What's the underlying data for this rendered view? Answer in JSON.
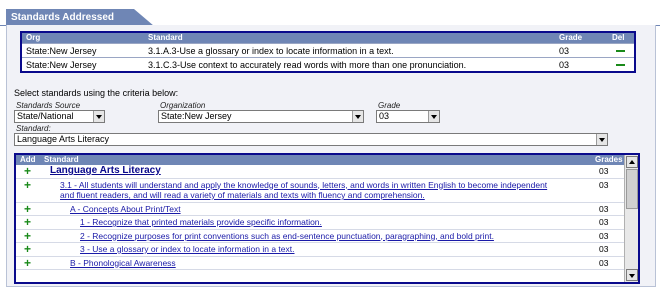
{
  "tab": {
    "title": "Standards Addressed"
  },
  "addressed": {
    "headers": {
      "org": "Org",
      "standard": "Standard",
      "grade": "Grade",
      "del": "Del"
    },
    "rows": [
      {
        "org": "State:New Jersey",
        "standard": "3.1.A.3-Use a glossary or index to locate information in a text.",
        "grade": "03"
      },
      {
        "org": "State:New Jersey",
        "standard": "3.1.C.3-Use context to accurately read words with more than one pronunciation.",
        "grade": "03"
      }
    ]
  },
  "criteria": {
    "label": "Select standards using the criteria below:",
    "source": {
      "label": "Standards Source",
      "value": "State/National"
    },
    "organization": {
      "label": "Organization",
      "value": "State:New Jersey"
    },
    "grade": {
      "label": "Grade",
      "value": "03"
    },
    "standard": {
      "label": "Standard:",
      "value": "Language Arts Literacy"
    }
  },
  "list": {
    "headers": {
      "add": "Add",
      "standard": "Standard",
      "grades": "Grades"
    },
    "items": [
      {
        "text": "Language Arts Literacy",
        "grade": "03"
      },
      {
        "text": "3.1 - All students will understand and apply the knowledge of sounds, letters, and words in written English to become independent and fluent readers, and will read a variety of materials and texts with fluency and comprehension.",
        "grade": "03"
      },
      {
        "text": "A - Concepts About Print/Text",
        "grade": "03"
      },
      {
        "text": "1 - Recognize that printed materials provide specific information.",
        "grade": "03"
      },
      {
        "text": "2 - Recognize purposes for print conventions such as end-sentence punctuation, paragraphing, and bold print.",
        "grade": "03"
      },
      {
        "text": "3 - Use a glossary or index to locate information in a text.",
        "grade": "03"
      },
      {
        "text": "B - Phonological Awareness",
        "grade": "03"
      }
    ]
  },
  "icons": {
    "add": "plus-icon",
    "delete": "minus-icon"
  },
  "colors": {
    "header": "#6f86b5",
    "border": "#0a0a8c",
    "link": "#1a1aa8",
    "add": "#1a8a1a"
  }
}
